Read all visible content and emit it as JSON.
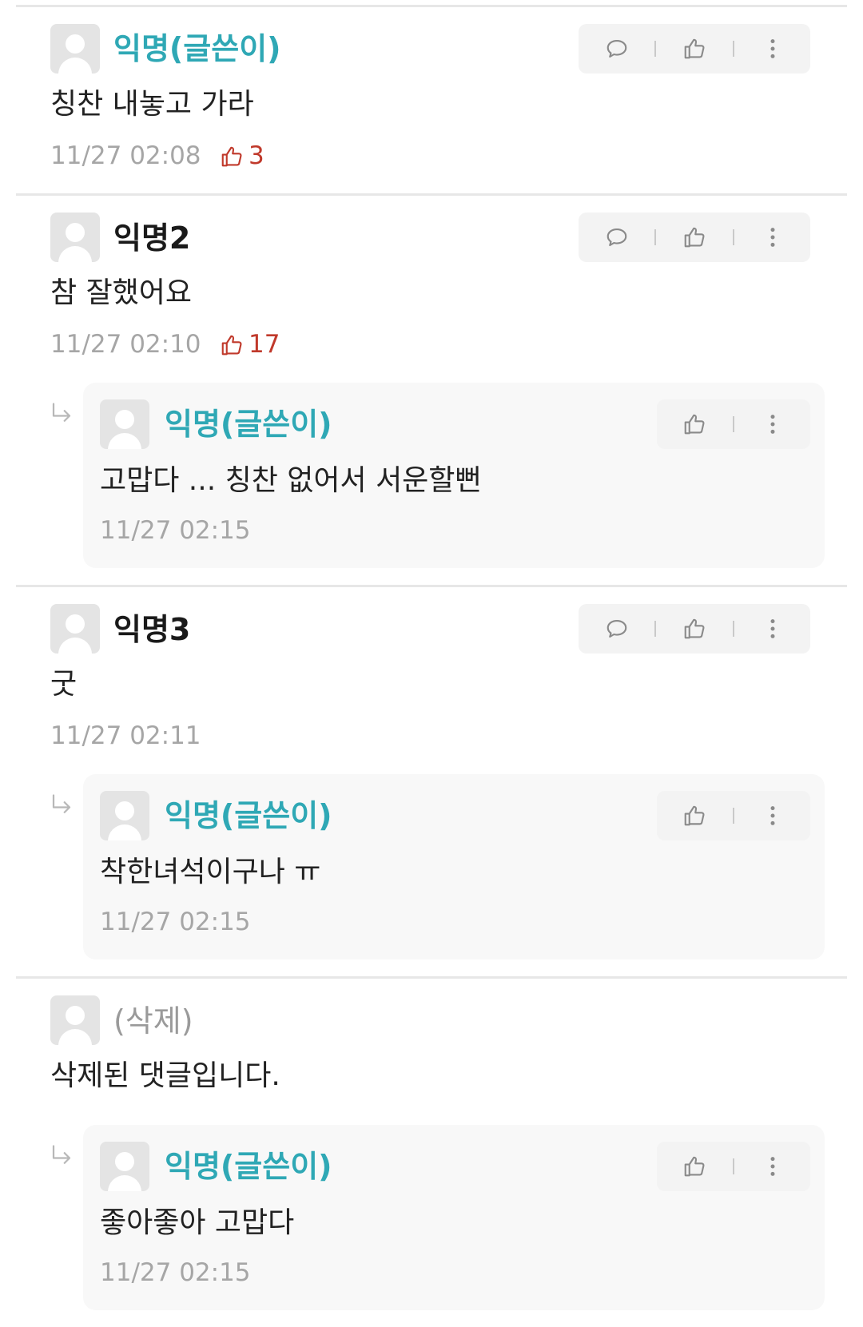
{
  "comments": [
    {
      "author": "익명(글쓴이)",
      "text": "칭찬 내놓고 가라",
      "time": "11/27 02:08",
      "likes": "3",
      "replies": []
    },
    {
      "author": "익명2",
      "text": "참 잘했어요",
      "time": "11/27 02:10",
      "likes": "17",
      "replies": [
        {
          "author": "익명(글쓴이)",
          "text": "고맙다 ... 칭찬 없어서 서운할뻔",
          "time": "11/27 02:15"
        }
      ]
    },
    {
      "author": "익명3",
      "text": "굿",
      "time": "11/27 02:11",
      "replies": [
        {
          "author": "익명(글쓴이)",
          "text": "착한녀석이구나 ㅠ",
          "time": "11/27 02:15"
        }
      ]
    },
    {
      "author": "(삭제)",
      "text": "삭제된 댓글입니다.",
      "replies": [
        {
          "author": "익명(글쓴이)",
          "text": "좋아좋아 고맙다",
          "time": "11/27 02:15"
        }
      ]
    }
  ],
  "colors": {
    "op_author": "#2fa8b5",
    "likes": "#c0392b",
    "meta": "#a6a6a6",
    "icons": "#8a8a8a"
  },
  "icons": {
    "reply": "speech-bubble-icon",
    "like": "thumbs-up-icon",
    "more": "vertical-dots-icon",
    "reply_marker": "reply-arrow-icon"
  }
}
